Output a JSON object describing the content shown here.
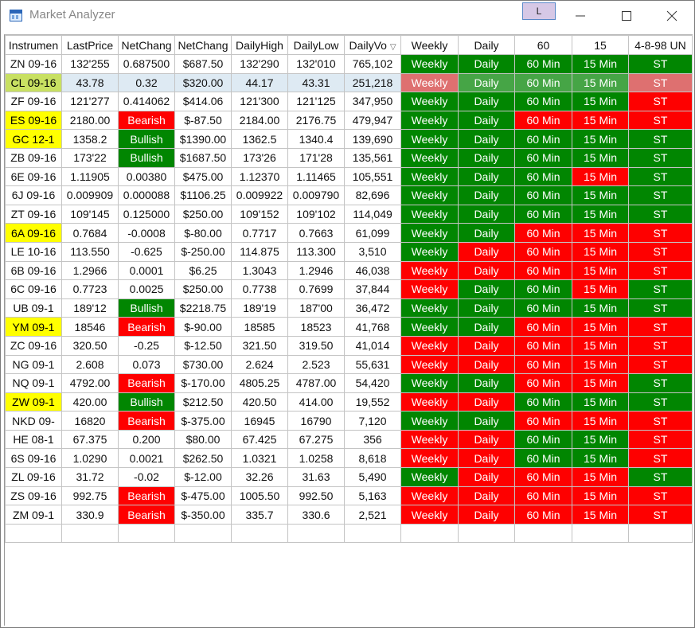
{
  "window": {
    "title": "Market Analyzer",
    "link_button_label": "L",
    "minimize_icon": "minimize-icon",
    "maximize_icon": "maximize-icon",
    "close_icon": "close-icon"
  },
  "colors": {
    "red": "#fe0000",
    "green": "#018601",
    "yellow": "#ffff00",
    "selected_row": "#deeaf3"
  },
  "columns": [
    "Instrumen",
    "LastPrice",
    "NetChang",
    "NetChang",
    "DailyHigh",
    "DailyLow",
    "DailyVo",
    "Weekly",
    "Daily",
    "60",
    "15",
    "4-8-98 UN"
  ],
  "sort_indicator": "▽",
  "rows": [
    {
      "cells": [
        "ZN 09-16",
        "132'255",
        "0.687500",
        "$687.50",
        "132'290",
        "132'010",
        "765,102",
        "Weekly",
        "Daily",
        "60 Min",
        "15 Min",
        "ST"
      ],
      "styles": [
        "",
        "",
        "",
        "",
        "",
        "",
        "",
        "green",
        "green",
        "green",
        "green",
        "green"
      ]
    },
    {
      "cells": [
        "CL 09-16",
        "43.78",
        "0.32",
        "$320.00",
        "44.17",
        "43.31",
        "251,218",
        "Weekly",
        "Daily",
        "60 Min",
        "15 Min",
        "ST"
      ],
      "styles": [
        "yellow",
        "",
        "",
        "",
        "",
        "",
        "",
        "red",
        "green",
        "green",
        "green",
        "red"
      ],
      "selected": true
    },
    {
      "cells": [
        "ZF 09-16",
        "121'277",
        "0.414062",
        "$414.06",
        "121'300",
        "121'125",
        "347,950",
        "Weekly",
        "Daily",
        "60 Min",
        "15 Min",
        "ST"
      ],
      "styles": [
        "",
        "",
        "",
        "",
        "",
        "",
        "",
        "green",
        "green",
        "green",
        "green",
        "red"
      ]
    },
    {
      "cells": [
        "ES 09-16",
        "2180.00",
        "Bearish",
        "$-87.50",
        "2184.00",
        "2176.75",
        "479,947",
        "Weekly",
        "Daily",
        "60 Min",
        "15 Min",
        "ST"
      ],
      "styles": [
        "yellow",
        "",
        "red",
        "",
        "",
        "",
        "",
        "green",
        "green",
        "red",
        "red",
        "red"
      ]
    },
    {
      "cells": [
        "GC 12-1",
        "1358.2",
        "Bullish",
        "$1390.00",
        "1362.5",
        "1340.4",
        "139,690",
        "Weekly",
        "Daily",
        "60 Min",
        "15 Min",
        "ST"
      ],
      "styles": [
        "yellow",
        "",
        "green",
        "",
        "",
        "",
        "",
        "green",
        "green",
        "green",
        "green",
        "green"
      ]
    },
    {
      "cells": [
        "ZB 09-16",
        "173'22",
        "Bullish",
        "$1687.50",
        "173'26",
        "171'28",
        "135,561",
        "Weekly",
        "Daily",
        "60 Min",
        "15 Min",
        "ST"
      ],
      "styles": [
        "",
        "",
        "green",
        "",
        "",
        "",
        "",
        "green",
        "green",
        "green",
        "green",
        "green"
      ]
    },
    {
      "cells": [
        "6E 09-16",
        "1.11905",
        "0.00380",
        "$475.00",
        "1.12370",
        "1.11465",
        "105,551",
        "Weekly",
        "Daily",
        "60 Min",
        "15 Min",
        "ST"
      ],
      "styles": [
        "",
        "",
        "",
        "",
        "",
        "",
        "",
        "green",
        "green",
        "green",
        "red",
        "green"
      ]
    },
    {
      "cells": [
        "6J 09-16",
        "0.009909",
        "0.000088",
        "$1106.25",
        "0.009922",
        "0.009790",
        "82,696",
        "Weekly",
        "Daily",
        "60 Min",
        "15 Min",
        "ST"
      ],
      "styles": [
        "",
        "",
        "",
        "",
        "",
        "",
        "",
        "green",
        "green",
        "green",
        "green",
        "green"
      ]
    },
    {
      "cells": [
        "ZT 09-16",
        "109'145",
        "0.125000",
        "$250.00",
        "109'152",
        "109'102",
        "114,049",
        "Weekly",
        "Daily",
        "60 Min",
        "15 Min",
        "ST"
      ],
      "styles": [
        "",
        "",
        "",
        "",
        "",
        "",
        "",
        "green",
        "green",
        "green",
        "green",
        "green"
      ]
    },
    {
      "cells": [
        "6A 09-16",
        "0.7684",
        "-0.0008",
        "$-80.00",
        "0.7717",
        "0.7663",
        "61,099",
        "Weekly",
        "Daily",
        "60 Min",
        "15 Min",
        "ST"
      ],
      "styles": [
        "yellow",
        "",
        "",
        "",
        "",
        "",
        "",
        "green",
        "green",
        "red",
        "red",
        "red"
      ]
    },
    {
      "cells": [
        "LE 10-16",
        "113.550",
        "-0.625",
        "$-250.00",
        "114.875",
        "113.300",
        "3,510",
        "Weekly",
        "Daily",
        "60 Min",
        "15 Min",
        "ST"
      ],
      "styles": [
        "",
        "",
        "",
        "",
        "",
        "",
        "",
        "green",
        "red",
        "red",
        "red",
        "red"
      ]
    },
    {
      "cells": [
        "6B 09-16",
        "1.2966",
        "0.0001",
        "$6.25",
        "1.3043",
        "1.2946",
        "46,038",
        "Weekly",
        "Daily",
        "60 Min",
        "15 Min",
        "ST"
      ],
      "styles": [
        "",
        "",
        "",
        "",
        "",
        "",
        "",
        "red",
        "red",
        "red",
        "red",
        "red"
      ]
    },
    {
      "cells": [
        "6C 09-16",
        "0.7723",
        "0.0025",
        "$250.00",
        "0.7738",
        "0.7699",
        "37,844",
        "Weekly",
        "Daily",
        "60 Min",
        "15 Min",
        "ST"
      ],
      "styles": [
        "",
        "",
        "",
        "",
        "",
        "",
        "",
        "red",
        "green",
        "green",
        "red",
        "green"
      ]
    },
    {
      "cells": [
        "UB 09-1",
        "189'12",
        "Bullish",
        "$2218.75",
        "189'19",
        "187'00",
        "36,472",
        "Weekly",
        "Daily",
        "60 Min",
        "15 Min",
        "ST"
      ],
      "styles": [
        "",
        "",
        "green",
        "",
        "",
        "",
        "",
        "green",
        "green",
        "green",
        "green",
        "green"
      ]
    },
    {
      "cells": [
        "YM 09-1",
        "18546",
        "Bearish",
        "$-90.00",
        "18585",
        "18523",
        "41,768",
        "Weekly",
        "Daily",
        "60 Min",
        "15 Min",
        "ST"
      ],
      "styles": [
        "yellow",
        "",
        "red",
        "",
        "",
        "",
        "",
        "green",
        "green",
        "red",
        "red",
        "red"
      ]
    },
    {
      "cells": [
        "ZC 09-16",
        "320.50",
        "-0.25",
        "$-12.50",
        "321.50",
        "319.50",
        "41,014",
        "Weekly",
        "Daily",
        "60 Min",
        "15 Min",
        "ST"
      ],
      "styles": [
        "",
        "",
        "",
        "",
        "",
        "",
        "",
        "red",
        "red",
        "red",
        "red",
        "red"
      ]
    },
    {
      "cells": [
        "NG 09-1",
        "2.608",
        "0.073",
        "$730.00",
        "2.624",
        "2.523",
        "55,631",
        "Weekly",
        "Daily",
        "60 Min",
        "15 Min",
        "ST"
      ],
      "styles": [
        "",
        "",
        "",
        "",
        "",
        "",
        "",
        "red",
        "red",
        "red",
        "red",
        "red"
      ]
    },
    {
      "cells": [
        "NQ 09-1",
        "4792.00",
        "Bearish",
        "$-170.00",
        "4805.25",
        "4787.00",
        "54,420",
        "Weekly",
        "Daily",
        "60 Min",
        "15 Min",
        "ST"
      ],
      "styles": [
        "",
        "",
        "red",
        "",
        "",
        "",
        "",
        "green",
        "green",
        "red",
        "red",
        "green"
      ]
    },
    {
      "cells": [
        "ZW 09-1",
        "420.00",
        "Bullish",
        "$212.50",
        "420.50",
        "414.00",
        "19,552",
        "Weekly",
        "Daily",
        "60 Min",
        "15 Min",
        "ST"
      ],
      "styles": [
        "yellow",
        "",
        "green",
        "",
        "",
        "",
        "",
        "red",
        "red",
        "green",
        "green",
        "green"
      ]
    },
    {
      "cells": [
        "NKD 09-",
        "16820",
        "Bearish",
        "$-375.00",
        "16945",
        "16790",
        "7,120",
        "Weekly",
        "Daily",
        "60 Min",
        "15 Min",
        "ST"
      ],
      "styles": [
        "",
        "",
        "red",
        "",
        "",
        "",
        "",
        "green",
        "green",
        "red",
        "red",
        "red"
      ]
    },
    {
      "cells": [
        "HE 08-1",
        "67.375",
        "0.200",
        "$80.00",
        "67.425",
        "67.275",
        "356",
        "Weekly",
        "Daily",
        "60 Min",
        "15 Min",
        "ST"
      ],
      "styles": [
        "",
        "",
        "",
        "",
        "",
        "",
        "",
        "red",
        "red",
        "green",
        "green",
        "red"
      ]
    },
    {
      "cells": [
        "6S 09-16",
        "1.0290",
        "0.0021",
        "$262.50",
        "1.0321",
        "1.0258",
        "8,618",
        "Weekly",
        "Daily",
        "60 Min",
        "15 Min",
        "ST"
      ],
      "styles": [
        "",
        "",
        "",
        "",
        "",
        "",
        "",
        "red",
        "red",
        "green",
        "green",
        "red"
      ]
    },
    {
      "cells": [
        "ZL 09-16",
        "31.72",
        "-0.02",
        "$-12.00",
        "32.26",
        "31.63",
        "5,490",
        "Weekly",
        "Daily",
        "60 Min",
        "15 Min",
        "ST"
      ],
      "styles": [
        "",
        "",
        "",
        "",
        "",
        "",
        "",
        "green",
        "red",
        "red",
        "red",
        "green"
      ]
    },
    {
      "cells": [
        "ZS 09-16",
        "992.75",
        "Bearish",
        "$-475.00",
        "1005.50",
        "992.50",
        "5,163",
        "Weekly",
        "Daily",
        "60 Min",
        "15 Min",
        "ST"
      ],
      "styles": [
        "",
        "",
        "red",
        "",
        "",
        "",
        "",
        "red",
        "red",
        "red",
        "red",
        "red"
      ]
    },
    {
      "cells": [
        "ZM 09-1",
        "330.9",
        "Bearish",
        "$-350.00",
        "335.7",
        "330.6",
        "2,521",
        "Weekly",
        "Daily",
        "60 Min",
        "15 Min",
        "ST"
      ],
      "styles": [
        "",
        "",
        "red",
        "",
        "",
        "",
        "",
        "red",
        "red",
        "red",
        "red",
        "red"
      ]
    }
  ]
}
